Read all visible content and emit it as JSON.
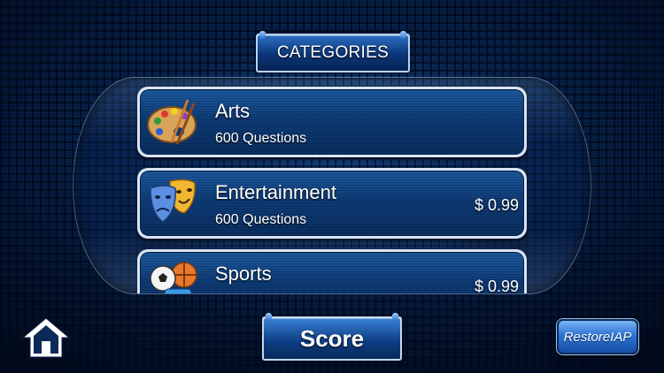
{
  "header": {
    "title": "CATEGORIES"
  },
  "categories": [
    {
      "title": "Arts",
      "subtitle": "600 Questions",
      "price": "",
      "icon": "palette-icon"
    },
    {
      "title": "Entertainment",
      "subtitle": "600 Questions",
      "price": "$ 0.99",
      "icon": "theater-masks-icon"
    },
    {
      "title": "Sports",
      "subtitle": "",
      "price": "$ 0.99",
      "icon": "sports-balls-icon"
    }
  ],
  "buttons": {
    "score_label": "Score",
    "restore_label": "RestoreIAP",
    "home_icon": "home-icon"
  }
}
